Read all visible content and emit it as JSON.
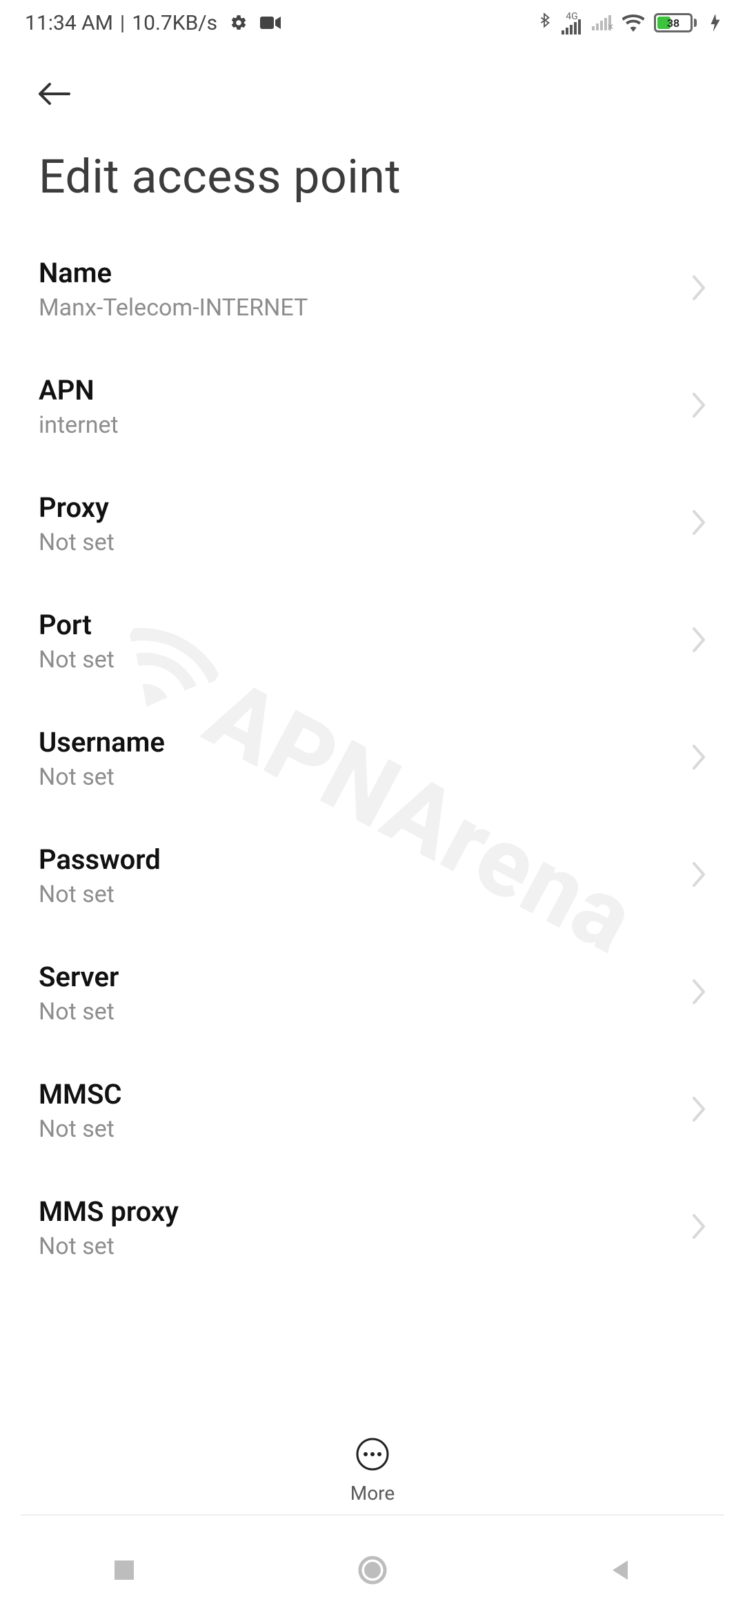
{
  "status": {
    "time": "11:34 AM",
    "sep": "|",
    "kbps": "10.7KB/s",
    "network_label": "4G",
    "battery_percent": "38"
  },
  "header": {
    "title": "Edit access point"
  },
  "items": [
    {
      "label": "Name",
      "value": "Manx-Telecom-INTERNET"
    },
    {
      "label": "APN",
      "value": "internet"
    },
    {
      "label": "Proxy",
      "value": "Not set"
    },
    {
      "label": "Port",
      "value": "Not set"
    },
    {
      "label": "Username",
      "value": "Not set"
    },
    {
      "label": "Password",
      "value": "Not set"
    },
    {
      "label": "Server",
      "value": "Not set"
    },
    {
      "label": "MMSC",
      "value": "Not set"
    },
    {
      "label": "MMS proxy",
      "value": "Not set"
    }
  ],
  "toolbar": {
    "more_label": "More"
  },
  "watermark": {
    "text": "APNArena"
  }
}
